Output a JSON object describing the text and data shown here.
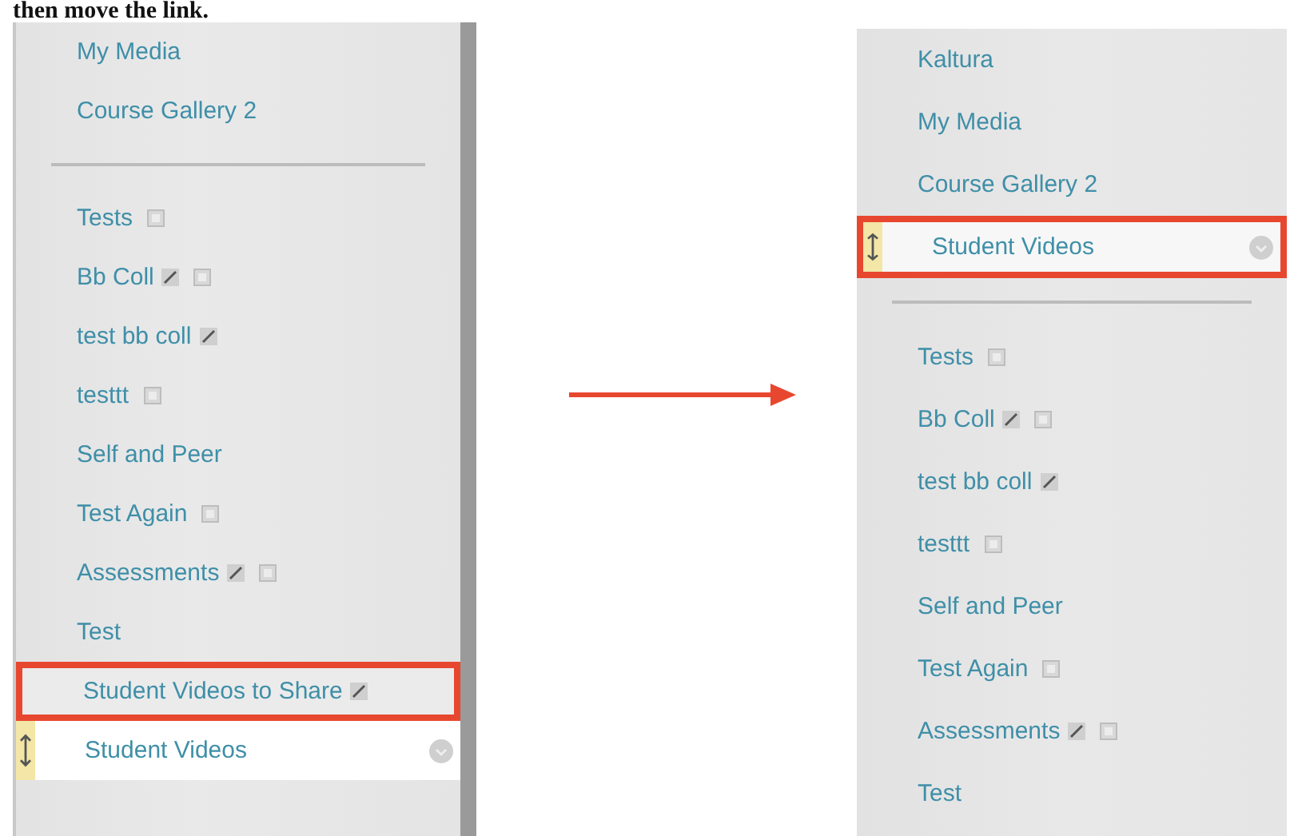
{
  "heading": "then move the link.",
  "before_menu": {
    "items": [
      {
        "kind": "item",
        "label": "My Media",
        "linked": false,
        "hidden": false,
        "highlighted": false
      },
      {
        "kind": "item",
        "label": "Course Gallery 2",
        "linked": false,
        "hidden": false,
        "highlighted": false
      },
      {
        "kind": "divider"
      },
      {
        "kind": "item",
        "label": "Tests",
        "linked": false,
        "hidden": true,
        "highlighted": false
      },
      {
        "kind": "item",
        "label": "Bb Coll",
        "linked": true,
        "hidden": true,
        "highlighted": false
      },
      {
        "kind": "item",
        "label": "test bb coll",
        "linked": true,
        "hidden": false,
        "highlighted": false
      },
      {
        "kind": "item",
        "label": "testtt",
        "linked": false,
        "hidden": true,
        "highlighted": false
      },
      {
        "kind": "item",
        "label": "Self and Peer",
        "linked": false,
        "hidden": false,
        "highlighted": false
      },
      {
        "kind": "item",
        "label": "Test Again",
        "linked": false,
        "hidden": true,
        "highlighted": false
      },
      {
        "kind": "item",
        "label": "Assessments",
        "linked": true,
        "hidden": true,
        "highlighted": false
      },
      {
        "kind": "item",
        "label": "Test",
        "linked": false,
        "hidden": false,
        "highlighted": false
      },
      {
        "kind": "item",
        "label": "Student Videos to Share",
        "linked": true,
        "hidden": false,
        "highlighted": true
      },
      {
        "kind": "drag",
        "label": "Student Videos",
        "linked": false,
        "hidden": false,
        "highlighted": false
      }
    ]
  },
  "after_menu": {
    "items": [
      {
        "kind": "item",
        "label": "Kaltura",
        "linked": false,
        "hidden": false,
        "highlighted": false
      },
      {
        "kind": "item",
        "label": "My Media",
        "linked": false,
        "hidden": false,
        "highlighted": false
      },
      {
        "kind": "item",
        "label": "Course Gallery 2",
        "linked": false,
        "hidden": false,
        "highlighted": false
      },
      {
        "kind": "drag",
        "label": "Student Videos",
        "linked": false,
        "hidden": false,
        "highlighted": true
      },
      {
        "kind": "divider"
      },
      {
        "kind": "item",
        "label": "Tests",
        "linked": false,
        "hidden": true,
        "highlighted": false
      },
      {
        "kind": "item",
        "label": "Bb Coll",
        "linked": true,
        "hidden": true,
        "highlighted": false
      },
      {
        "kind": "item",
        "label": "test bb coll",
        "linked": true,
        "hidden": false,
        "highlighted": false
      },
      {
        "kind": "item",
        "label": "testtt",
        "linked": false,
        "hidden": true,
        "highlighted": false
      },
      {
        "kind": "item",
        "label": "Self and Peer",
        "linked": false,
        "hidden": false,
        "highlighted": false
      },
      {
        "kind": "item",
        "label": "Test Again",
        "linked": false,
        "hidden": true,
        "highlighted": false
      },
      {
        "kind": "item",
        "label": "Assessments",
        "linked": true,
        "hidden": true,
        "highlighted": false
      },
      {
        "kind": "item",
        "label": "Test",
        "linked": false,
        "hidden": false,
        "highlighted": false
      }
    ]
  }
}
